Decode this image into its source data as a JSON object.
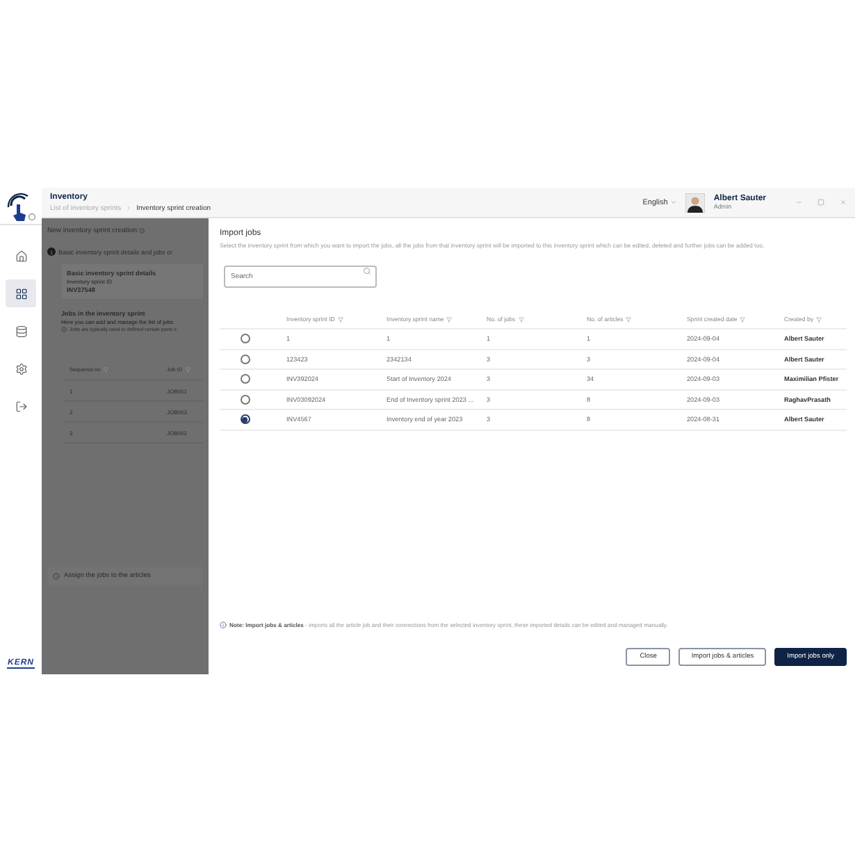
{
  "sidebar": {
    "items": [
      {
        "selected": false
      },
      {
        "selected": true
      },
      {
        "selected": false
      },
      {
        "selected": false
      },
      {
        "selected": false
      }
    ],
    "brand": "KERN"
  },
  "header": {
    "title": "Inventory",
    "breadcrumb": [
      {
        "label": "List of inventory sprints",
        "current": false
      },
      {
        "label": "Inventory sprint creation",
        "current": true
      }
    ],
    "language": "English",
    "user": {
      "name": "Albert Sauter",
      "role": "Admin"
    }
  },
  "background_page": {
    "title": "New inventory sprint creation",
    "step_number": "1",
    "step_title": "Basic inventory sprint details and jobs cr",
    "card_title": "Basic inventory sprint details",
    "id_label": "Inventory sprint ID",
    "id_value": "INV37548",
    "jobs_title": "Jobs in the inventory sprint",
    "jobs_subtitle": "Here you can add and manage the list of jobs",
    "jobs_hint": "Jobs are typically used to defined certain parts o",
    "columns": [
      "Sequence no",
      "Job ID"
    ],
    "rows": [
      [
        "1",
        "JOB001"
      ],
      [
        "2",
        "JOB003"
      ],
      [
        "3",
        "JOB002"
      ]
    ],
    "next_step": "Assign the jobs to the articles"
  },
  "dialog": {
    "title": "Import jobs",
    "description": "Select the inventory sprint from which you want to import the jobs, all the jobs from that inventory sprint will be imported to this inventory sprint which can be edited, deleted and further jobs can be added too.",
    "search": {
      "placeholder": "Search"
    },
    "columns": [
      "Inventory sprint ID",
      "Inventory sprint name",
      "No. of jobs",
      "No. of articles",
      "Sprint created date",
      "Created by"
    ],
    "rows": [
      {
        "selected": false,
        "cells": [
          "1",
          "1",
          "1",
          "1",
          "2024-09-04",
          "Albert Sauter"
        ]
      },
      {
        "selected": false,
        "cells": [
          "123423",
          "2342134",
          "3",
          "3",
          "2024-09-04",
          "Albert Sauter"
        ]
      },
      {
        "selected": false,
        "cells": [
          "INV392024",
          "Start of Inventory 2024",
          "3",
          "34",
          "2024-09-03",
          "Maximilian Pfister"
        ]
      },
      {
        "selected": false,
        "cells": [
          "INV03092024",
          "End of Inventory sprint 2023 ...",
          "3",
          "8",
          "2024-09-03",
          "RaghavPrasath"
        ]
      },
      {
        "selected": true,
        "cells": [
          "INV4567",
          "Inventory end of year 2023",
          "3",
          "8",
          "2024-08-31",
          "Albert Sauter"
        ]
      }
    ],
    "note": "**Note: Import jobs & articles** - imports all the article job and their connections from the selected inventory sprint, these imported details can be edited and managed manually.",
    "buttons": [
      {
        "label": "Close",
        "kind": "outline"
      },
      {
        "label": "Import jobs & articles",
        "kind": "outline"
      },
      {
        "label": "Import jobs only",
        "kind": "primary"
      }
    ]
  }
}
